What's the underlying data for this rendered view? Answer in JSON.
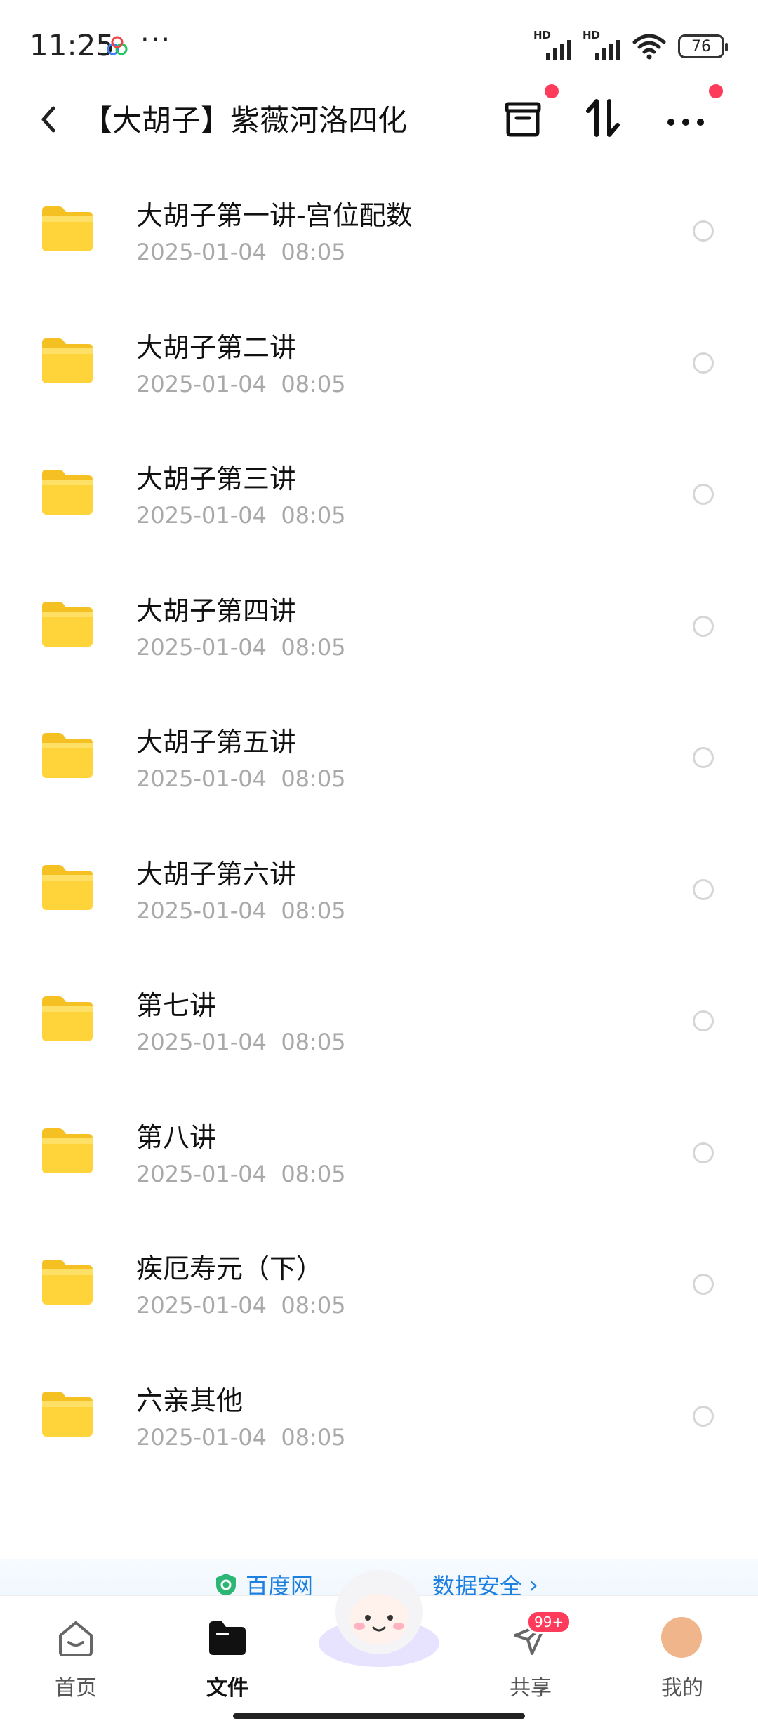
{
  "status_bar": {
    "time": "11:25",
    "more": "···",
    "battery": "76",
    "signal_label": "HD"
  },
  "header": {
    "title": "【大胡子】紫薇河洛四化"
  },
  "files": [
    {
      "name": "大胡子第一讲-宫位配数",
      "date": "2025-01-04  08:05"
    },
    {
      "name": "大胡子第二讲",
      "date": "2025-01-04  08:05"
    },
    {
      "name": "大胡子第三讲",
      "date": "2025-01-04  08:05"
    },
    {
      "name": "大胡子第四讲",
      "date": "2025-01-04  08:05"
    },
    {
      "name": "大胡子第五讲",
      "date": "2025-01-04  08:05"
    },
    {
      "name": "大胡子第六讲",
      "date": "2025-01-04  08:05"
    },
    {
      "name": "第七讲",
      "date": "2025-01-04  08:05"
    },
    {
      "name": "第八讲",
      "date": "2025-01-04  08:05"
    },
    {
      "name": "疾厄寿元（下）",
      "date": "2025-01-04  08:05"
    },
    {
      "name": "六亲其他",
      "date": "2025-01-04  08:05"
    }
  ],
  "banner": {
    "text_left": "百度网",
    "text_right": "数据安全",
    "chevron": "›"
  },
  "nav": {
    "home": "首页",
    "files": "文件",
    "share": "共享",
    "share_badge": "99+",
    "me": "我的"
  },
  "colors": {
    "accent_blue": "#1d7fe0",
    "badge_red": "#ff3b5c",
    "folder_yellow": "#ffd43b"
  }
}
